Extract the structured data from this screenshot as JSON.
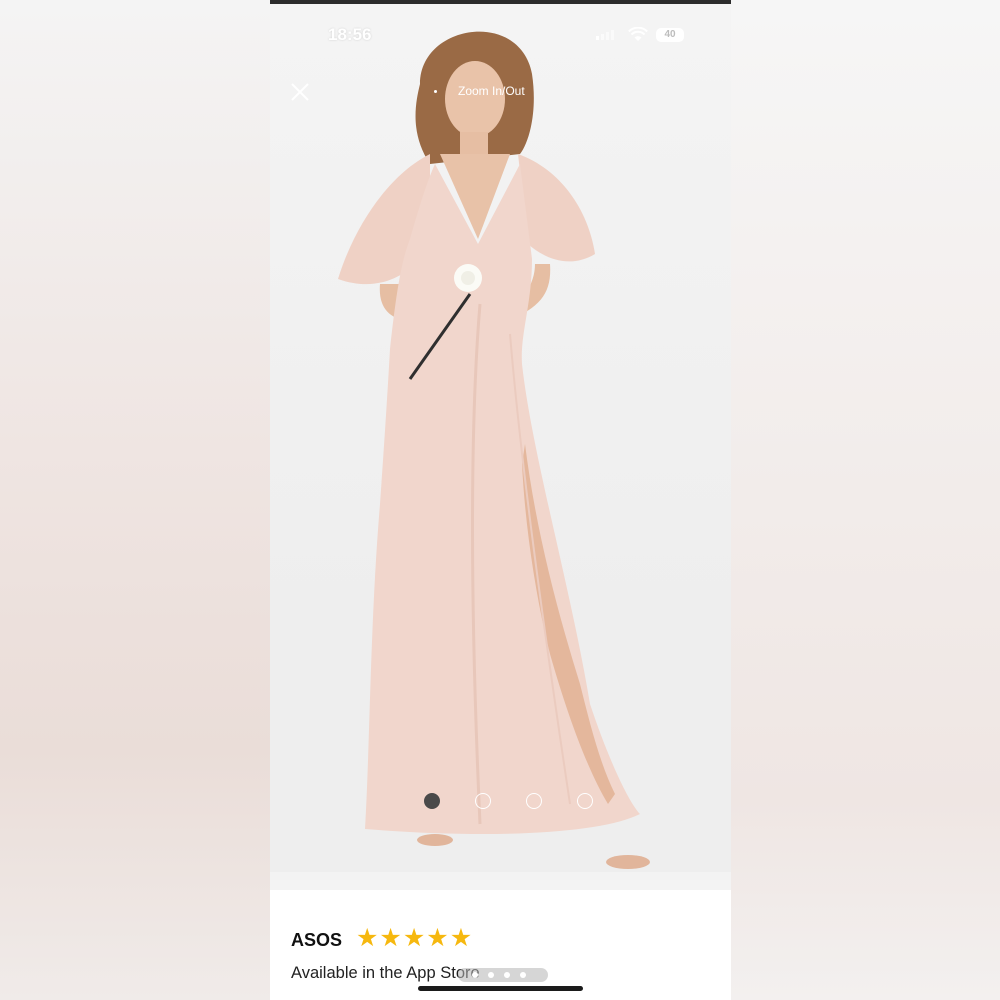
{
  "status_bar": {
    "time": "18:56",
    "battery": "40"
  },
  "viewer": {
    "zoom_hint": "Zoom In/Out",
    "close_icon": "close-icon",
    "pagination": {
      "count": 4,
      "active_index": 0
    }
  },
  "ad_banner": {
    "brand": "ASOS",
    "rating_stars": 5,
    "subtitle": "Available in the App Store",
    "star_color": "#f6b80f"
  },
  "colors": {
    "dress": "#f1d6cc",
    "background": "#f2f2f2"
  }
}
